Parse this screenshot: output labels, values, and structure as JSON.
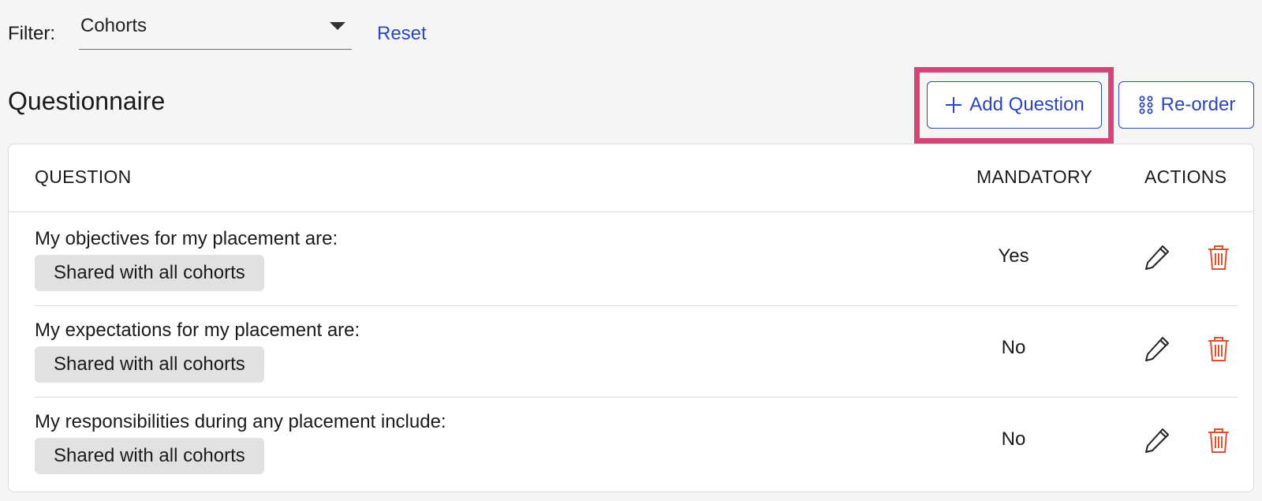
{
  "filter": {
    "label": "Filter:",
    "selected": "Cohorts",
    "reset_label": "Reset"
  },
  "section": {
    "title": "Questionnaire",
    "add_button_label": "Add Question",
    "reorder_button_label": "Re-order"
  },
  "table": {
    "headers": {
      "question": "QUESTION",
      "mandatory": "MANDATORY",
      "actions": "ACTIONS"
    },
    "rows": [
      {
        "question": "My objectives for my placement are:",
        "badge": "Shared with all cohorts",
        "mandatory": "Yes"
      },
      {
        "question": "My expectations for my placement are:",
        "badge": "Shared with all cohorts",
        "mandatory": "No"
      },
      {
        "question": "My responsibilities during any placement include:",
        "badge": "Shared with all cohorts",
        "mandatory": "No"
      }
    ]
  },
  "icons": {
    "add": "plus-icon",
    "reorder": "grid-dots-icon",
    "edit": "pencil-icon",
    "delete": "trash-icon",
    "dropdown": "chevron-down-icon"
  },
  "colors": {
    "accent": "#2d46b9",
    "highlight": "#d2467a",
    "delete": "#e0502f",
    "badge_bg": "#e1e1e1",
    "page_bg": "#f5f5f5"
  }
}
